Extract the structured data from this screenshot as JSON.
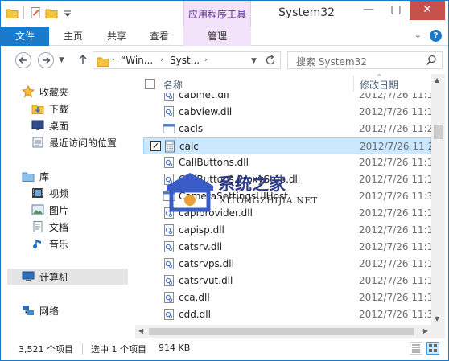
{
  "window": {
    "title": "System32",
    "context_tab": "应用程序工具"
  },
  "ribbon": {
    "tabs": [
      "文件",
      "主页",
      "共享",
      "查看",
      "管理"
    ],
    "expand_glyph": "⌄",
    "help_label": "?"
  },
  "caption": {
    "minimize": "—",
    "maximize": "□",
    "close": "✕"
  },
  "nav": {
    "address_segments": [
      "“Win...",
      "Syst..."
    ],
    "search_placeholder": "搜索 System32"
  },
  "columns": {
    "name": "名称",
    "date": "修改日期"
  },
  "sidebar": {
    "items": [
      {
        "label": "收藏夹",
        "icon": "star-icon"
      },
      {
        "label": "下载",
        "icon": "downloads-folder-icon"
      },
      {
        "label": "桌面",
        "icon": "desktop-icon"
      },
      {
        "label": "最近访问的位置",
        "icon": "recent-places-icon"
      },
      {
        "label": "库",
        "icon": "library-icon"
      },
      {
        "label": "视频",
        "icon": "video-library-icon"
      },
      {
        "label": "图片",
        "icon": "pictures-library-icon"
      },
      {
        "label": "文档",
        "icon": "documents-library-icon"
      },
      {
        "label": "音乐",
        "icon": "music-library-icon"
      },
      {
        "label": "计算机",
        "icon": "computer-icon"
      },
      {
        "label": "网络",
        "icon": "network-icon"
      }
    ]
  },
  "files": [
    {
      "name": "cabinet.dll",
      "date": "2012/7/26 11:1",
      "icon": "dll-file-icon"
    },
    {
      "name": "cabview.dll",
      "date": "2012/7/26 11:1",
      "icon": "dll-file-icon"
    },
    {
      "name": "cacls",
      "date": "2012/7/26 11:2",
      "icon": "exe-file-icon"
    },
    {
      "name": "calc",
      "date": "2012/7/26 11:2",
      "icon": "calculator-app-icon",
      "selected": true
    },
    {
      "name": "CallButtons.dll",
      "date": "2012/7/26 11:1",
      "icon": "dll-file-icon"
    },
    {
      "name": "CallButtons.ProxyStub.dll",
      "date": "2012/7/26 11:1",
      "icon": "dll-file-icon"
    },
    {
      "name": "CameraSettingsUIHost",
      "date": "2012/7/26 11:3",
      "icon": "exe-file-icon"
    },
    {
      "name": "capiprovider.dll",
      "date": "2012/7/26 11:1",
      "icon": "dll-file-icon"
    },
    {
      "name": "capisp.dll",
      "date": "2012/7/26 11:1",
      "icon": "dll-file-icon"
    },
    {
      "name": "catsrv.dll",
      "date": "2012/7/26 11:1",
      "icon": "dll-file-icon"
    },
    {
      "name": "catsrvps.dll",
      "date": "2012/7/26 11:1",
      "icon": "dll-file-icon"
    },
    {
      "name": "catsrvut.dll",
      "date": "2012/7/26 11:1",
      "icon": "dll-file-icon"
    },
    {
      "name": "cca.dll",
      "date": "2012/7/26 11:1",
      "icon": "dll-file-icon"
    },
    {
      "name": "cdd.dll",
      "date": "2012/7/26 11:3",
      "icon": "dll-file-icon"
    }
  ],
  "status": {
    "item_count": "3,521 个项目",
    "selection": "选中 1 个项目",
    "size": "914 KB"
  },
  "watermark": {
    "text": "系统之家",
    "url": "XITONGZHIJIA.NET"
  },
  "colors": {
    "accent": "#1979ca",
    "context_tab_bg": "#f3e3fa",
    "selection_bg": "#cce8ff",
    "selection_border": "#99d1ff",
    "close_button": "#c7504b"
  }
}
